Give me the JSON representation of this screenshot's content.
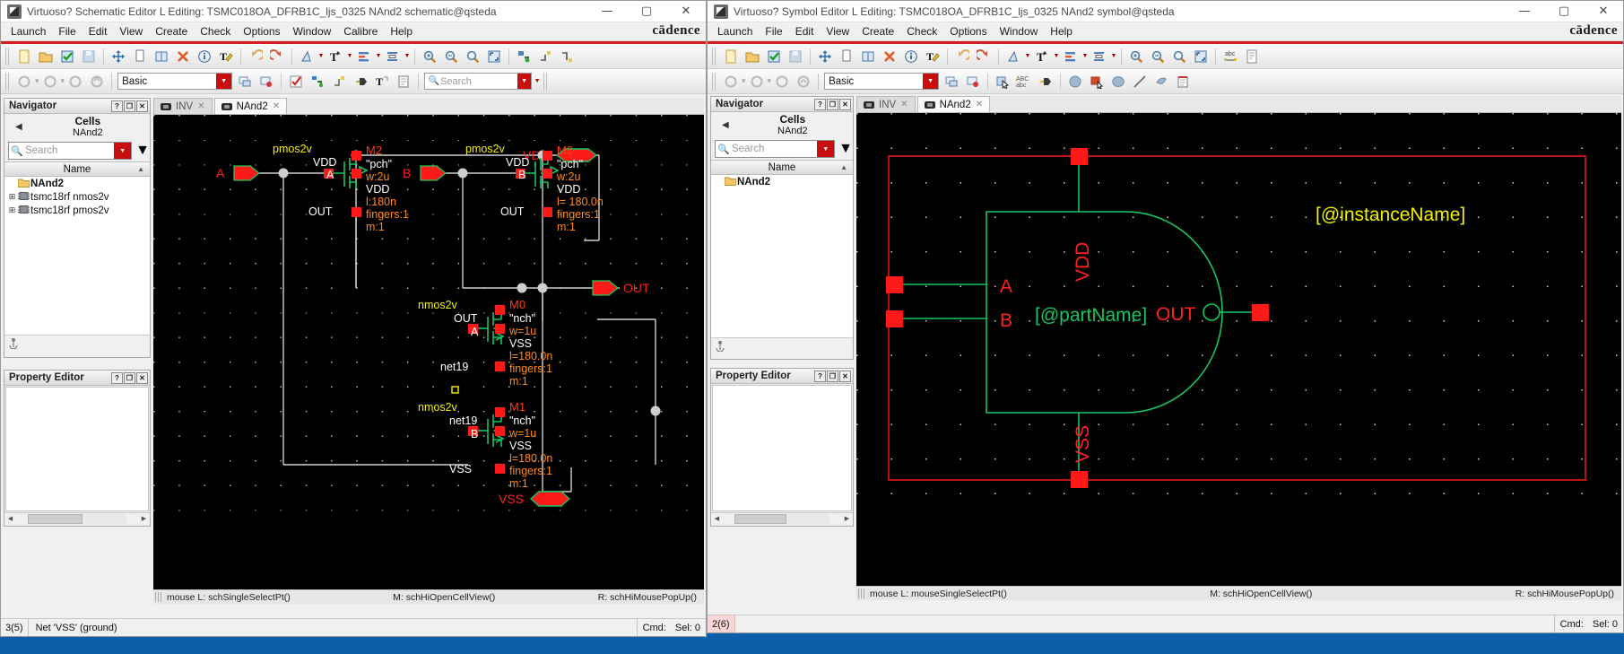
{
  "left_window": {
    "title": "Virtuoso? Schematic Editor L Editing: TSMC018OA_DFRB1C_ljs_0325 NAnd2 schematic@qsteda",
    "brand": "cādence",
    "window_buttons": {
      "minimize": "—",
      "maximize": "▢",
      "close": "✕"
    },
    "menus": [
      "Launch",
      "File",
      "Edit",
      "View",
      "Create",
      "Check",
      "Options",
      "Window",
      "Calibre",
      "Help"
    ],
    "toolbar": {
      "library_combo_value": "Basic",
      "search_placeholder": "Search"
    },
    "navigator": {
      "title": "Navigator",
      "help_btn": "?",
      "float_btn": "❐",
      "close_btn": "✕",
      "back_arrow": "◀",
      "scope_label": "Cells",
      "scope_value": "NAnd2",
      "search_placeholder": "Search",
      "column_header": "Name",
      "items": [
        {
          "label": "NAnd2",
          "icon": "folder-icon",
          "expandable": false,
          "bold": true
        },
        {
          "label": "tsmc18rf nmos2v",
          "icon": "chip-icon",
          "expandable": true,
          "bold": false
        },
        {
          "label": "tsmc18rf pmos2v",
          "icon": "chip-icon",
          "expandable": true,
          "bold": false
        }
      ]
    },
    "property_editor": {
      "title": "Property Editor",
      "help_btn": "?",
      "float_btn": "❐",
      "close_btn": "✕"
    },
    "tabs": [
      {
        "label": "INV",
        "active": false
      },
      {
        "label": "NAnd2",
        "active": true
      }
    ],
    "status": {
      "left": "mouse L: schSingleSelectPt()",
      "center": "M: schHiOpenCellView()",
      "right": "R: schHiMousePopUp()"
    },
    "bottom": {
      "cell_sel": "3(5)",
      "message": "Net 'VSS' (ground)",
      "cmd": "Cmd:",
      "sel": "Sel: 0"
    },
    "schematic": {
      "nets": [
        "VDD",
        "VSS",
        "OUT",
        "net19"
      ],
      "pins": [
        "A",
        "B",
        "OUT"
      ],
      "devices": [
        {
          "name": "M2",
          "model": "pmos2v",
          "type": "\"pch\"",
          "w": "w:2u",
          "l": "l:180n",
          "fingers": "fingers:1",
          "m": "m:1",
          "terms": [
            "VDD",
            "A",
            "VDD",
            "OUT"
          ]
        },
        {
          "name": "M3",
          "model": "pmos2v",
          "type": "\"pch\"",
          "w": "w:2u",
          "l": "l= 180.0n",
          "fingers": "fingers:1",
          "m": "m:1",
          "terms": [
            "VDD",
            "B",
            "VDD",
            "OUT"
          ]
        },
        {
          "name": "M0",
          "model": "nmos2v",
          "type": "\"nch\"",
          "w": "w=1u",
          "l": "l=180.0n",
          "fingers": "fingers:1",
          "m": "m:1",
          "terms": [
            "OUT",
            "A",
            "VSS",
            "net19"
          ]
        },
        {
          "name": "M1",
          "model": "nmos2v",
          "type": "\"nch\"",
          "w": "w=1u",
          "l": "l=180.0n",
          "fingers": "fingers:1",
          "m": "m:1",
          "terms": [
            "net19",
            "B",
            "VSS",
            "VSS"
          ]
        }
      ]
    }
  },
  "right_window": {
    "title": "Virtuoso? Symbol Editor L Editing: TSMC018OA_DFRB1C_ljs_0325 NAnd2 symbol@qsteda",
    "brand": "cādence",
    "window_buttons": {
      "minimize": "—",
      "maximize": "▢",
      "close": "✕"
    },
    "menus": [
      "Launch",
      "File",
      "Edit",
      "View",
      "Create",
      "Check",
      "Options",
      "Window",
      "Help"
    ],
    "toolbar": {
      "library_combo_value": "Basic",
      "abc_label": "ABC",
      "abc_sub": "abc"
    },
    "navigator": {
      "title": "Navigator",
      "help_btn": "?",
      "float_btn": "❐",
      "close_btn": "✕",
      "back_arrow": "◀",
      "scope_label": "Cells",
      "scope_value": "NAnd2",
      "search_placeholder": "Search",
      "column_header": "Name",
      "items": [
        {
          "label": "NAnd2",
          "icon": "folder-icon",
          "expandable": false,
          "bold": true
        }
      ]
    },
    "property_editor": {
      "title": "Property Editor",
      "help_btn": "?",
      "float_btn": "❐",
      "close_btn": "✕"
    },
    "tabs": [
      {
        "label": "INV",
        "active": false
      },
      {
        "label": "NAnd2",
        "active": true
      }
    ],
    "status": {
      "left": "mouse L: mouseSingleSelectPt()",
      "center": "M: schHiOpenCellView()",
      "right": "R: schHiMousePopUp()"
    },
    "bottom": {
      "cell_sel": "2(6)",
      "message": "",
      "cmd": "Cmd:",
      "sel": "Sel: 0"
    },
    "symbol": {
      "pin_labels": [
        "A",
        "B",
        "OUT",
        "VDD",
        "VSS"
      ],
      "part_name_label": "[@partName]",
      "instance_name_label": "[@instanceName]"
    }
  },
  "colors": {
    "accent_red": "#d21e1e",
    "net_red": "#ff2020",
    "device_orange": "#ff8c1a",
    "model_yellow": "#f2f200",
    "wire_white": "#d4d4d4",
    "symbol_green": "#19c462",
    "canvas_black": "#000000"
  }
}
